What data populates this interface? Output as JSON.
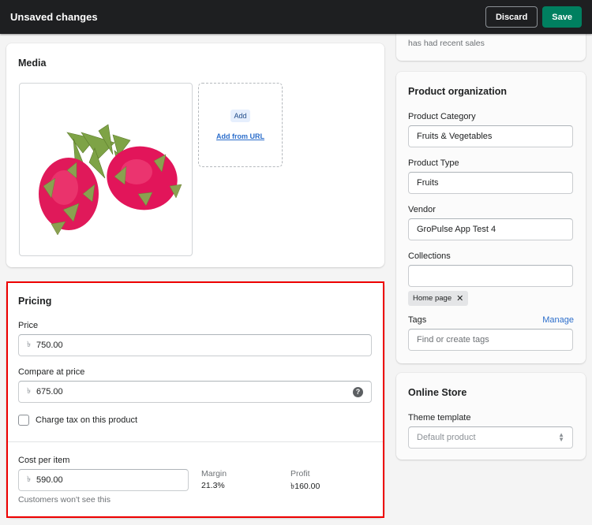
{
  "topbar": {
    "title": "Unsaved changes",
    "discard_label": "Discard",
    "save_label": "Save",
    "save_color": "#008060"
  },
  "media": {
    "title": "Media",
    "image_alt": "Two dragon fruits",
    "add_label": "Add",
    "add_url_label": "Add from URL"
  },
  "pricing": {
    "title": "Pricing",
    "currency_symbol": "৳",
    "price_label": "Price",
    "price_value": "750.00",
    "compare_label": "Compare at price",
    "compare_value": "675.00",
    "tax_label": "Charge tax on this product",
    "tax_checked": false,
    "cost_label": "Cost per item",
    "cost_value": "590.00",
    "cost_help": "Customers won't see this",
    "margin_label": "Margin",
    "margin_value": "21.3%",
    "profit_label": "Profit",
    "profit_value": "৳160.00"
  },
  "sales_channels_snippet": {
    "text": "has had recent sales"
  },
  "organization": {
    "title": "Product organization",
    "category_label": "Product Category",
    "category_value": "Fruits & Vegetables",
    "type_label": "Product Type",
    "type_value": "Fruits",
    "vendor_label": "Vendor",
    "vendor_value": "GroPulse App Test 4",
    "collections_label": "Collections",
    "collections_value": "",
    "collection_tags": [
      "Home page"
    ],
    "tags_label": "Tags",
    "tags_manage": "Manage",
    "tags_placeholder": "Find or create tags"
  },
  "online_store": {
    "title": "Online Store",
    "theme_label": "Theme template",
    "theme_value": "Default product"
  }
}
